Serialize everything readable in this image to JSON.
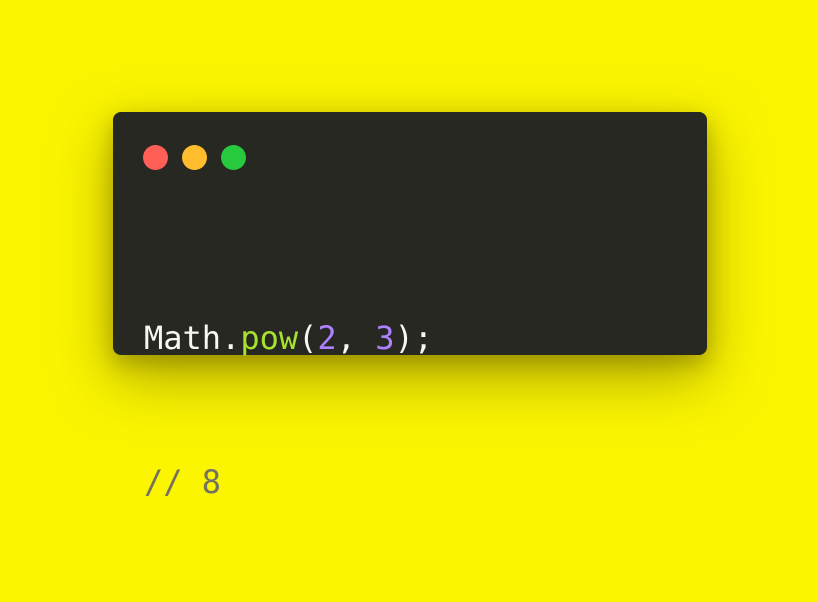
{
  "window": {
    "controls": [
      {
        "name": "close",
        "color": "#ff5f56"
      },
      {
        "name": "minimize",
        "color": "#ffbd2e"
      },
      {
        "name": "maximize",
        "color": "#27c93f"
      }
    ]
  },
  "code": {
    "line1": {
      "object": "Math",
      "dot": ".",
      "method": "pow",
      "open_paren": "(",
      "arg1": "2",
      "comma": ", ",
      "arg2": "3",
      "close": ");"
    },
    "line2": {
      "comment": "// 8"
    }
  },
  "colors": {
    "background": "#fbf500",
    "editor_bg": "#272822",
    "text": "#f8f8f2",
    "function": "#a6e22e",
    "number": "#ae81ff",
    "comment": "#75715e"
  }
}
